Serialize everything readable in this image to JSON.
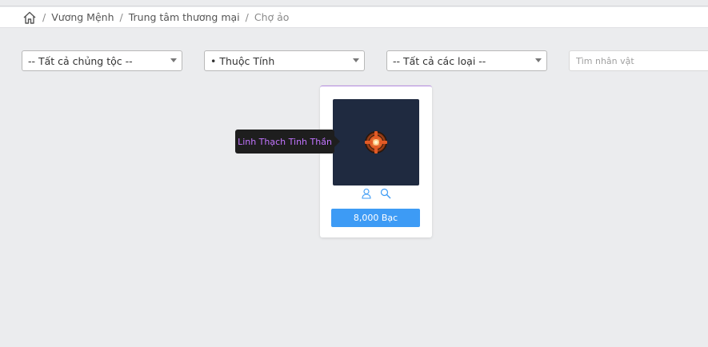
{
  "breadcrumb": {
    "items": [
      "Vương Mệnh",
      "Trung tâm thương mại",
      "Chợ ảo"
    ]
  },
  "filters": {
    "race_select": "-- Tất cả chủng tộc --",
    "attribute_select": "• Thuộc Tính",
    "type_select": "-- Tất cả các loại --",
    "search_placeholder": "Tìm nhân vật"
  },
  "item_card": {
    "tooltip": "Linh Thạch Tinh Thần",
    "price_label": "8,000 Bạc"
  },
  "colors": {
    "accent": "#3d9bf5",
    "tooltip_text": "#c274ff",
    "thumb_bg": "#1f2a40"
  }
}
